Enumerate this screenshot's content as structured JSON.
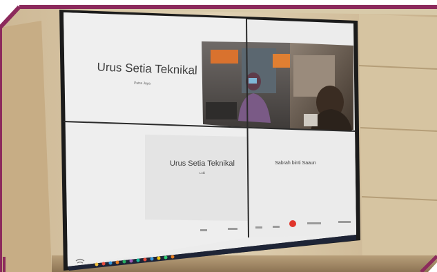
{
  "colors": {
    "frame": "#8c2a5c",
    "wall": "#d9c9a8",
    "screen_bezel": "#1b1b1b",
    "tile_light": "#efefef",
    "record_dot": "#e0352b"
  },
  "tiles": {
    "top_left": {
      "name": "Urus Setia Teknikal",
      "subtitle": "Putra Jaya"
    },
    "bottom_left": {
      "name": "Urus Setia Teknikal",
      "subtitle": "Lobi"
    },
    "bottom_right": {
      "name": "Sabrah binti Saaun"
    }
  },
  "icons": [
    "wifi-icon",
    "windows-taskbar-icons",
    "camera-icon",
    "mic-icon",
    "record-icon"
  ]
}
